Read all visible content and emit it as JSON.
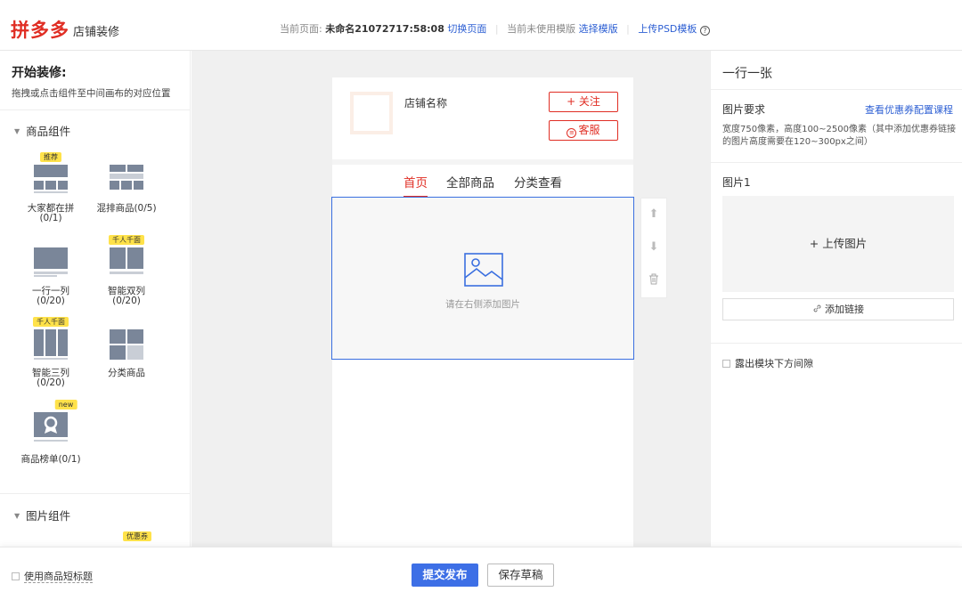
{
  "header": {
    "logo": "拼多多",
    "logo_sub": "店铺装修",
    "current_page_label": "当前页面:",
    "current_page_name": "未命名21072717:58:08",
    "switch_page": "切换页面",
    "template_status": "当前未使用模版",
    "choose_template": "选择模版",
    "upload_psd": "上传PSD模板"
  },
  "left": {
    "title": "开始装修:",
    "desc": "拖拽或点击组件至中间画布的对应位置",
    "product_section": "商品组件",
    "components": [
      {
        "label": "大家都在拼",
        "count": "(0/1)",
        "tag": "推荐"
      },
      {
        "label": "混排商品(0/5)",
        "count": "",
        "tag": ""
      },
      {
        "label": "一行一列",
        "count": "(0/20)",
        "tag": ""
      },
      {
        "label": "智能双列",
        "count": "(0/20)",
        "tag": "千人千面"
      },
      {
        "label": "智能三列",
        "count": "(0/20)",
        "tag": "千人千面"
      },
      {
        "label": "分类商品",
        "count": "",
        "tag": ""
      },
      {
        "label": "商品榜单(0/1)",
        "count": "",
        "tag": "new"
      }
    ],
    "image_section": "图片组件",
    "image_tag": "优惠券"
  },
  "canvas": {
    "shop_name": "店铺名称",
    "follow": "+ 关注",
    "service": "客服",
    "tabs": [
      "首页",
      "全部商品",
      "分类查看"
    ],
    "placeholder": "请在右侧添加图片"
  },
  "right": {
    "title": "一行一张",
    "requirement": "图片要求",
    "course_link": "查看优惠券配置课程",
    "desc": "宽度750像素，高度100~2500像素（其中添加优惠券链接的图片高度需要在120~300px之间）",
    "image_title": "图片1",
    "upload": "+ 上传图片",
    "add_link": "添加链接",
    "show_gap": "露出模块下方间隙"
  },
  "bottom": {
    "short_title": "使用商品短标题",
    "publish": "提交发布",
    "draft": "保存草稿"
  },
  "colors": {
    "brand_red": "#e02e24",
    "link_blue": "#2d5fd3",
    "primary_blue": "#3d6fe6",
    "tag_yellow": "#ffe24a"
  }
}
